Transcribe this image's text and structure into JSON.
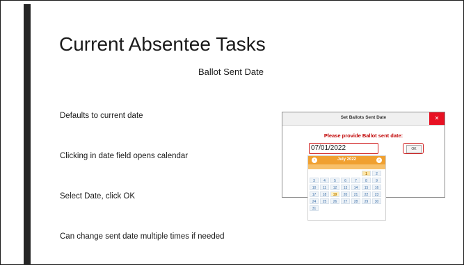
{
  "slide": {
    "title": "Current Absentee Tasks",
    "subtitle": "Ballot Sent Date",
    "bullets": [
      "Defaults to current date",
      "Clicking in date field opens calendar",
      "Select Date, click OK",
      "Can change sent date multiple times if needed"
    ]
  },
  "dialog": {
    "title": "Set Ballots Sent Date",
    "close_glyph": "✕",
    "prompt": "Please provide Ballot sent date:",
    "date_value": "07/01/2022",
    "ok_label": "OK"
  },
  "calendar": {
    "month_label": "July 2022",
    "prev_glyph": "‹",
    "next_glyph": "›",
    "days": [
      "1",
      "2",
      "3",
      "4",
      "5",
      "6",
      "7",
      "8",
      "9",
      "10",
      "11",
      "12",
      "13",
      "14",
      "15",
      "16",
      "17",
      "18",
      "19",
      "20",
      "21",
      "22",
      "23",
      "24",
      "25",
      "26",
      "27",
      "28",
      "29",
      "30",
      "31"
    ],
    "selected_day": "1",
    "highlighted_day": "19"
  },
  "colors": {
    "accent": "#f0a030",
    "prompt": "#c00000",
    "highlight_border": "#d02020"
  }
}
